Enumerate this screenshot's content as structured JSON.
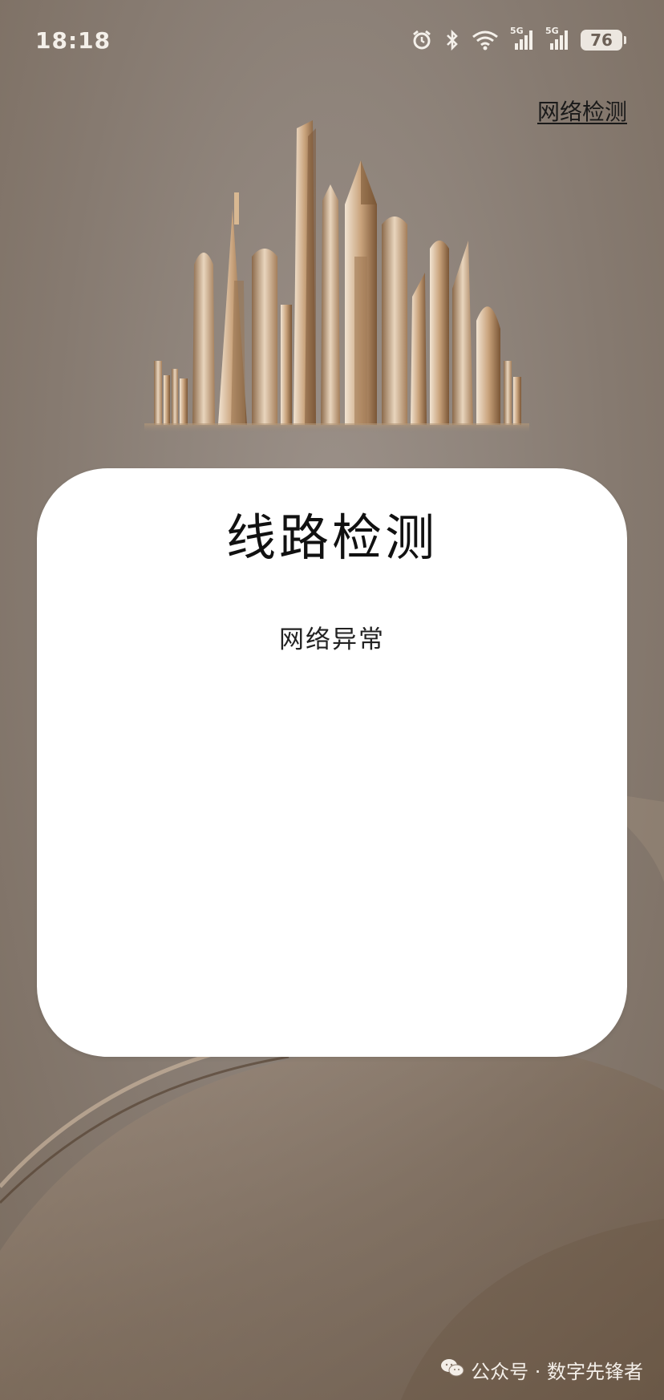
{
  "status_bar": {
    "time": "18:18",
    "network_1": "5G",
    "network_2": "5G",
    "battery": "76",
    "icons": [
      "alarm-icon",
      "bluetooth-icon",
      "wifi-icon",
      "signal-icon",
      "signal-icon",
      "battery-icon"
    ]
  },
  "header": {
    "network_check_link": "网络检测"
  },
  "card": {
    "title": "线路检测",
    "status": "网络异常"
  },
  "watermark": {
    "text": "公众号 · 数字先锋者",
    "icon": "wechat-icon"
  },
  "colors": {
    "background": "#8f847b",
    "card": "#ffffff",
    "skyline_gold": "#b8926a",
    "text_dark": "#111111"
  }
}
